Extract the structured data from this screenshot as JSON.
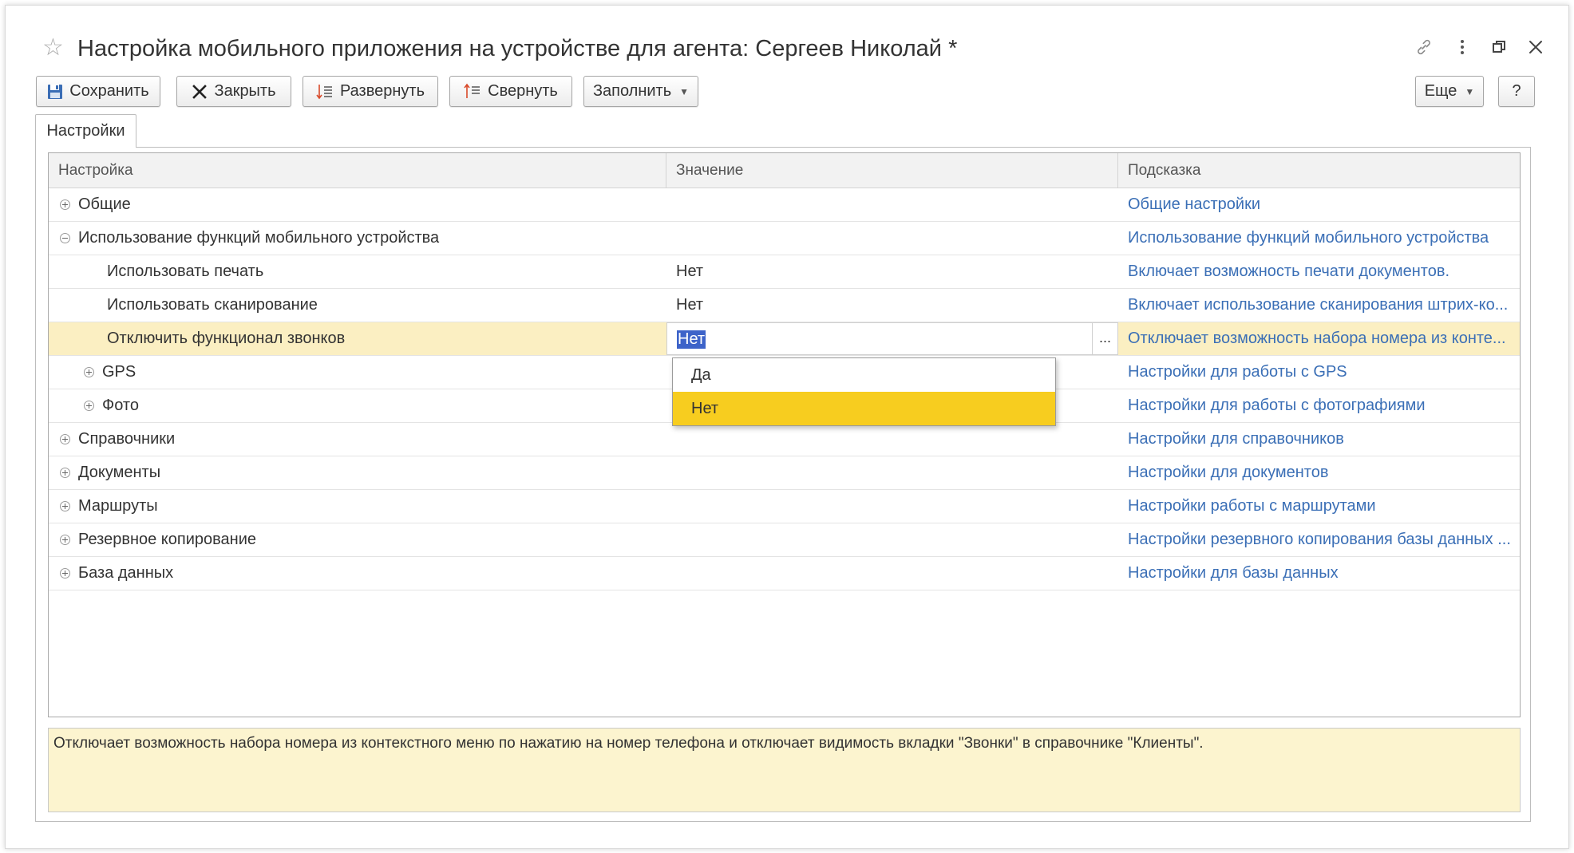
{
  "window": {
    "title": "Настройка мобильного приложения на устройстве для агента: Сергеев Николай *",
    "star_icon": "star-icon",
    "controls": [
      "link-icon",
      "more-vertical-icon",
      "restore-icon",
      "close-icon"
    ]
  },
  "toolbar": {
    "save_label": "Сохранить",
    "close_label": "Закрыть",
    "expand_label": "Развернуть",
    "collapse_label": "Свернуть",
    "fill_label": "Заполнить",
    "more_label": "Еще",
    "help_label": "?"
  },
  "tabs": [
    {
      "label": "Настройки"
    }
  ],
  "grid": {
    "columns": [
      "Настройка",
      "Значение",
      "Подсказка"
    ],
    "rows": [
      {
        "name": "Общие",
        "value": "",
        "hint": "Общие настройки",
        "level": 0,
        "expander": "plus"
      },
      {
        "name": "Использование функций мобильного устройства",
        "value": "",
        "hint": "Использование функций мобильного устройства",
        "level": 0,
        "expander": "minus"
      },
      {
        "name": "Использовать печать",
        "value": "Нет",
        "hint": "Включает возможность печати документов.",
        "level": 1,
        "expander": "none"
      },
      {
        "name": "Использовать сканирование",
        "value": "Нет",
        "hint": "Включает использование сканирования штрих-ко...",
        "level": 1,
        "expander": "none"
      },
      {
        "name": "Отключить функционал звонков",
        "value": "Нет",
        "hint": "Отключает возможность набора номера из конте...",
        "level": 1,
        "expander": "none",
        "selected": true
      },
      {
        "name": "GPS",
        "value": "",
        "hint": "Настройки для работы с GPS",
        "level": 1,
        "expander": "plus"
      },
      {
        "name": "Фото",
        "value": "",
        "hint": "Настройки для работы с фотографиями",
        "level": 1,
        "expander": "plus"
      },
      {
        "name": "Справочники",
        "value": "",
        "hint": "Настройки для справочников",
        "level": 0,
        "expander": "plus"
      },
      {
        "name": "Документы",
        "value": "",
        "hint": "Настройки для документов",
        "level": 0,
        "expander": "plus"
      },
      {
        "name": "Маршруты",
        "value": "",
        "hint": "Настройки работы с маршрутами",
        "level": 0,
        "expander": "plus"
      },
      {
        "name": "Резервное копирование",
        "value": "",
        "hint": "Настройки резервного копирования базы данных ...",
        "level": 0,
        "expander": "plus"
      },
      {
        "name": "База данных",
        "value": "",
        "hint": "Настройки для базы данных",
        "level": 0,
        "expander": "plus"
      }
    ]
  },
  "editor": {
    "value": "Нет",
    "choice_button": "..."
  },
  "dropdown": {
    "options": [
      "Да",
      "Нет"
    ],
    "selected": "Нет"
  },
  "hint_text": "Отключает возможность набора номера из контекстного меню по нажатию на номер телефона и отключает видимость вкладки \"Звонки\" в справочнике \"Клиенты\".",
  "colors": {
    "accent_link": "#3b6fb6",
    "selected_row": "#fbefc2",
    "dropdown_active": "#f7cd1f",
    "hint_background": "#fcf4cf",
    "text_selection": "#3d63c9"
  }
}
